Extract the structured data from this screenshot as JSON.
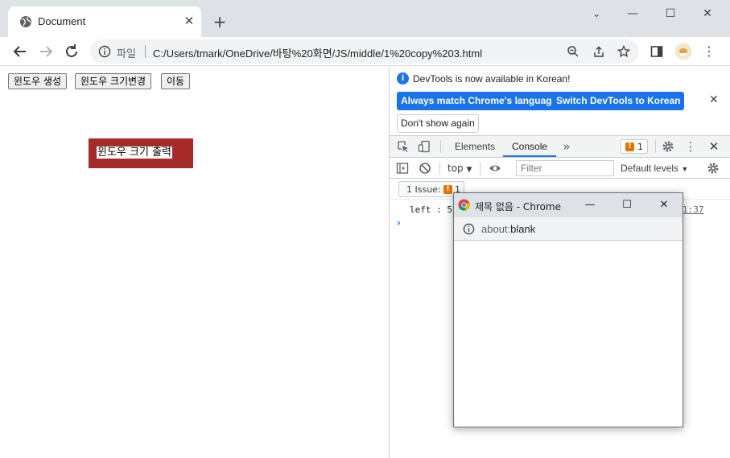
{
  "browser": {
    "tab": {
      "title": "Document"
    },
    "url_scheme": "파일",
    "url": "C:/Users/tmark/OneDrive/바탕%20화면/JS/middle/1%20copy%203.html"
  },
  "page": {
    "buttons": {
      "create": "윈도우 생성",
      "resize": "윈도우 크기변경",
      "move": "이동"
    },
    "output_box": "윈도우 크기 출력"
  },
  "devtools": {
    "banner": {
      "message": "DevTools is now available in Korean!",
      "match_btn": "Always match Chrome's language",
      "switch_btn": "Switch DevTools to Korean",
      "dismiss_btn": "Don't show again"
    },
    "tabs": {
      "elements": "Elements",
      "console": "Console"
    },
    "issues_badge_count": "1",
    "console_bar": {
      "context": "top",
      "filter_placeholder": "Filter",
      "levels": "Default levels"
    },
    "issues_chip": {
      "label": "1 Issue:",
      "count": "1"
    },
    "log": {
      "text": "left : 5",
      "source": "1:37"
    }
  },
  "popup": {
    "title": "제목 없음 - Chrome",
    "url_scheme": "about:",
    "url_path": "blank"
  },
  "colors": {
    "output_box_bg": "#a52a2a",
    "devtools_accent": "#1a73e8",
    "warning": "#e37400"
  }
}
